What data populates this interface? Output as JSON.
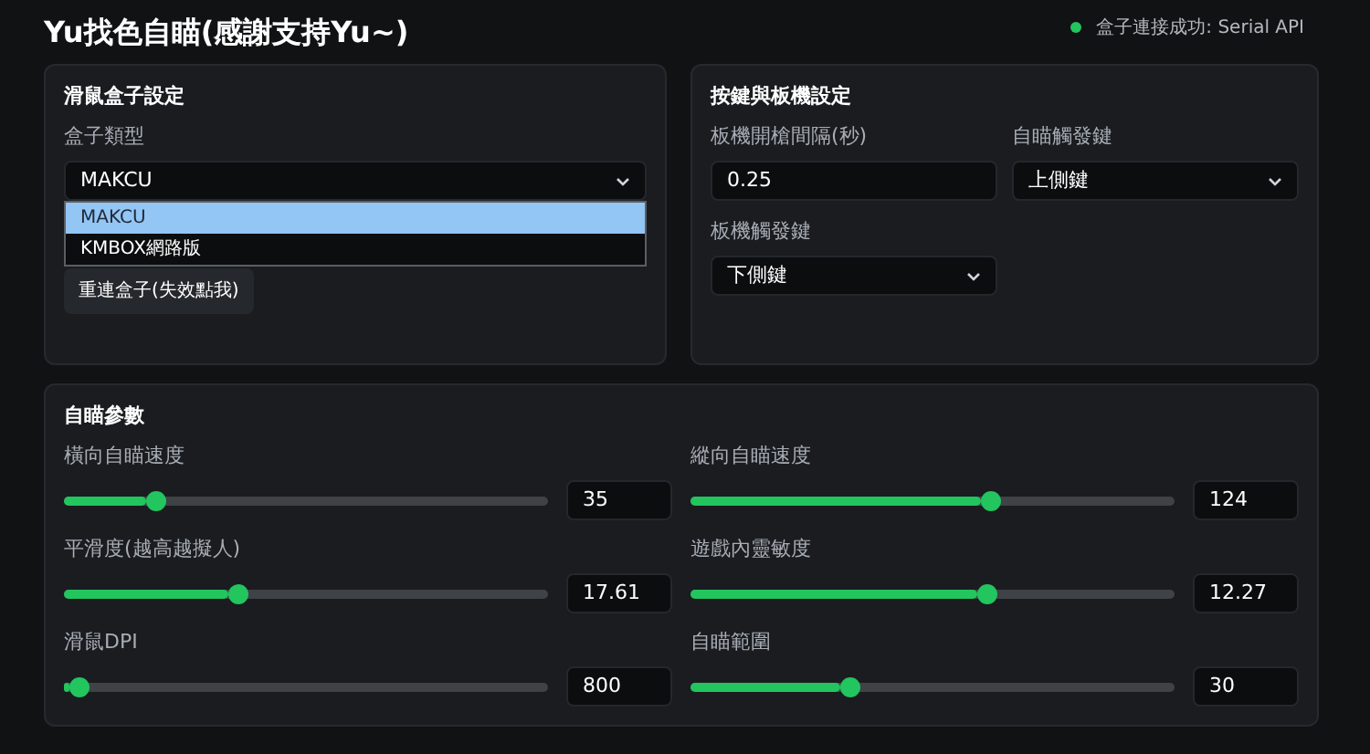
{
  "header": {
    "title": "Yu找色自瞄(感謝支持Yu~)",
    "status": {
      "connected": true,
      "text": "盒子連接成功: Serial API"
    }
  },
  "box_settings": {
    "title": "滑鼠盒子設定",
    "type_label": "盒子類型",
    "type_value": "MAKCU",
    "dropdown_open": true,
    "options": [
      {
        "label": "MAKCU",
        "selected": true
      },
      {
        "label": "KMBOX網路版",
        "selected": false
      }
    ],
    "reconnect_button": "重連盒子(失效點我)"
  },
  "trigger_settings": {
    "title": "按鍵與板機設定",
    "fields": [
      {
        "kind": "input",
        "label": "板機開槍間隔(秒)",
        "value": "0.25"
      },
      {
        "kind": "select",
        "label": "自瞄觸發鍵",
        "value": "上側鍵"
      },
      {
        "kind": "select",
        "label": "板機觸發鍵",
        "value": "下側鍵"
      }
    ]
  },
  "aim_params": {
    "title": "自瞄參數",
    "sliders": [
      {
        "label": "橫向自瞄速度",
        "level": 0.19,
        "value": "35"
      },
      {
        "label": "縱向自瞄速度",
        "level": 0.62,
        "value": "124"
      },
      {
        "label": "平滑度(越高越擬人)",
        "level": 0.36,
        "value": "17.61"
      },
      {
        "label": "遊戲內靈敏度",
        "level": 0.61,
        "value": "12.27"
      },
      {
        "label": "滑鼠DPI",
        "level": 0.03,
        "value": "800"
      },
      {
        "label": "自瞄範圍",
        "level": 0.33,
        "value": "30"
      }
    ]
  }
}
